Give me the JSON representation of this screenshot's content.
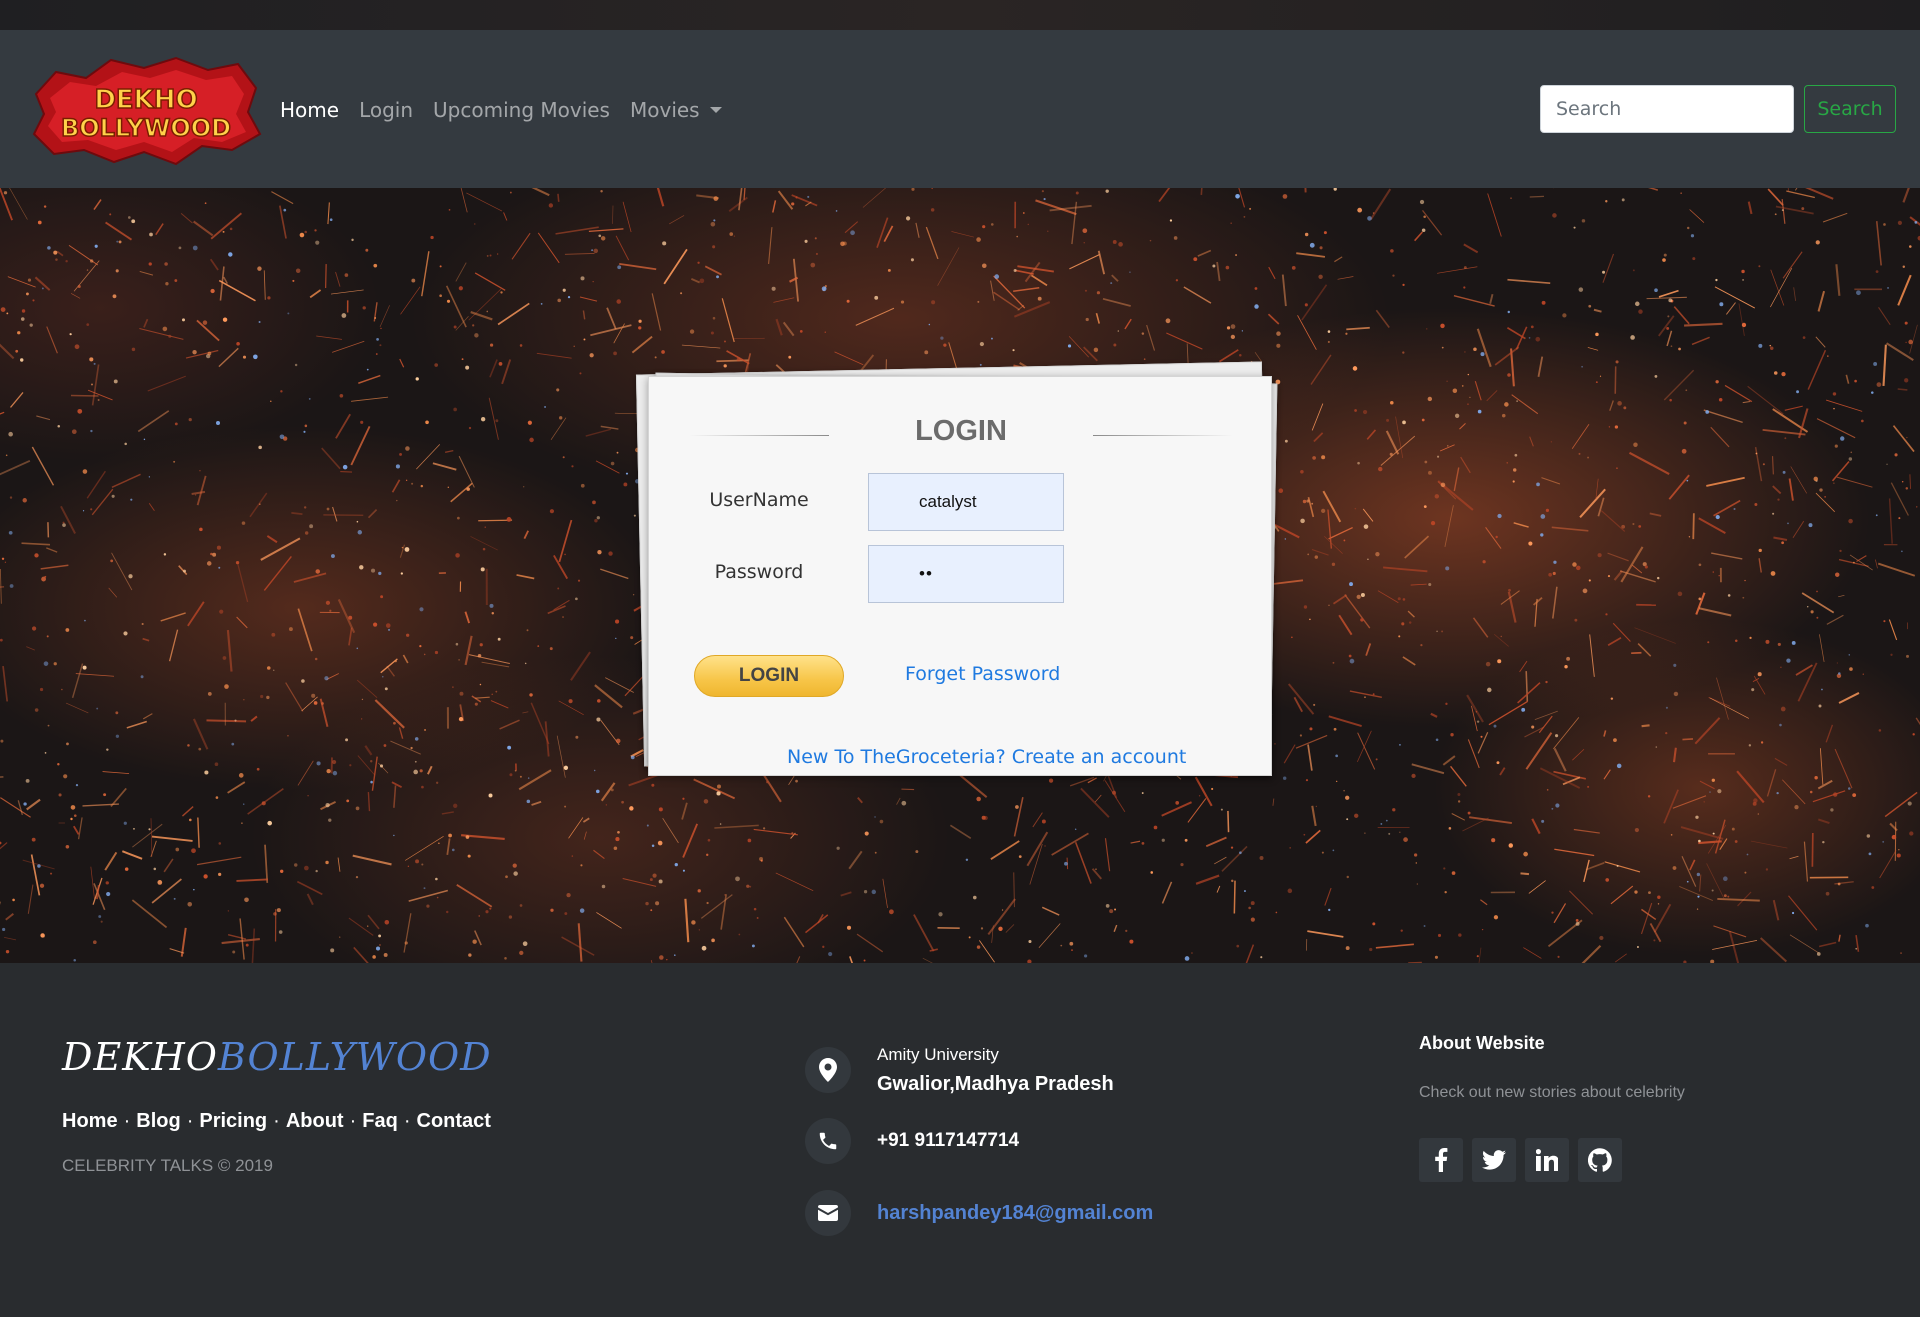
{
  "navbar": {
    "logo": {
      "line1": "DEKHO",
      "line2": "BOLLYWOOD"
    },
    "links": [
      {
        "label": "Home",
        "active": true
      },
      {
        "label": "Login",
        "active": false
      },
      {
        "label": "Upcoming Movies",
        "active": false
      },
      {
        "label": "Movies",
        "active": false,
        "dropdown": true
      }
    ],
    "search_placeholder": "Search",
    "search_button": "Search"
  },
  "login": {
    "title": "LOGIN",
    "username_label": "UserName",
    "username_value": "catalyst",
    "password_label": "Password",
    "password_value": "••",
    "login_button": "LOGIN",
    "forget_password": "Forget Password",
    "create_account": "New To TheGroceteria? Create an account"
  },
  "footer": {
    "brand_white": "DEKHO",
    "brand_blue": "BOLLYWOOD",
    "links": [
      "Home",
      "Blog",
      "Pricing",
      "About",
      "Faq",
      "Contact"
    ],
    "copyright": "CELEBRITY TALKS © 2019",
    "address_line1": "Amity University",
    "address_line2": "Gwalior,Madhya Pradesh",
    "phone": "+91 9117147714",
    "email": "harshpandey184@gmail.com",
    "about_title": "About Website",
    "about_text": "Check out new stories about celebrity",
    "social": [
      "facebook-icon",
      "twitter-icon",
      "linkedin-icon",
      "github-icon"
    ]
  },
  "colors": {
    "navbar_bg": "#343a40",
    "footer_bg": "#292c2f",
    "search_green": "#28a745",
    "link_blue": "#1f7ae0",
    "brand_blue": "#5383d3",
    "login_yellow": "#f7c548"
  }
}
